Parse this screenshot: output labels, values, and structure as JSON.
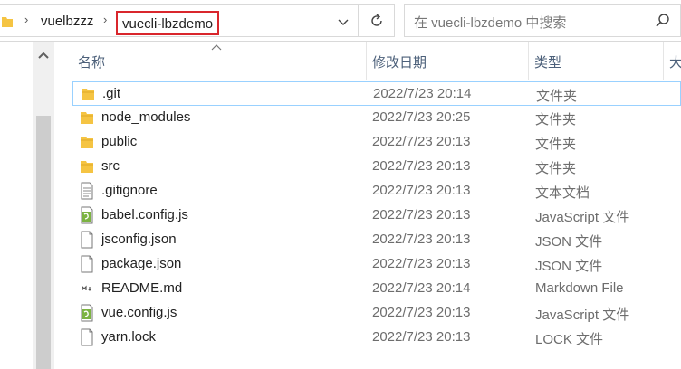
{
  "address_bar": {
    "breadcrumb_parent": "vuelbzzz",
    "breadcrumb_current": "vuecli-lbzdemo"
  },
  "search": {
    "placeholder": "在 vuecli-lbzdemo 中搜索"
  },
  "columns": {
    "name": "名称",
    "date_modified": "修改日期",
    "type": "类型",
    "size_partial": "大"
  },
  "files": [
    {
      "name": ".git",
      "date": "2022/7/23 20:14",
      "type": "文件夹",
      "icon": "folder-icon"
    },
    {
      "name": "node_modules",
      "date": "2022/7/23 20:25",
      "type": "文件夹",
      "icon": "folder-icon"
    },
    {
      "name": "public",
      "date": "2022/7/23 20:13",
      "type": "文件夹",
      "icon": "folder-icon"
    },
    {
      "name": "src",
      "date": "2022/7/23 20:13",
      "type": "文件夹",
      "icon": "folder-icon"
    },
    {
      "name": ".gitignore",
      "date": "2022/7/23 20:13",
      "type": "文本文档",
      "icon": "text-file-icon"
    },
    {
      "name": "babel.config.js",
      "date": "2022/7/23 20:13",
      "type": "JavaScript 文件",
      "icon": "js-file-icon"
    },
    {
      "name": "jsconfig.json",
      "date": "2022/7/23 20:13",
      "type": "JSON 文件",
      "icon": "json-file-icon"
    },
    {
      "name": "package.json",
      "date": "2022/7/23 20:13",
      "type": "JSON 文件",
      "icon": "json-file-icon"
    },
    {
      "name": "README.md",
      "date": "2022/7/23 20:14",
      "type": "Markdown File",
      "icon": "markdown-file-icon"
    },
    {
      "name": "vue.config.js",
      "date": "2022/7/23 20:13",
      "type": "JavaScript 文件",
      "icon": "js-file-icon"
    },
    {
      "name": "yarn.lock",
      "date": "2022/7/23 20:13",
      "type": "LOCK 文件",
      "icon": "lock-file-icon"
    }
  ],
  "colors": {
    "highlight_border": "#d9262c",
    "folder": "#f5c443",
    "header_text": "#4c607a"
  }
}
